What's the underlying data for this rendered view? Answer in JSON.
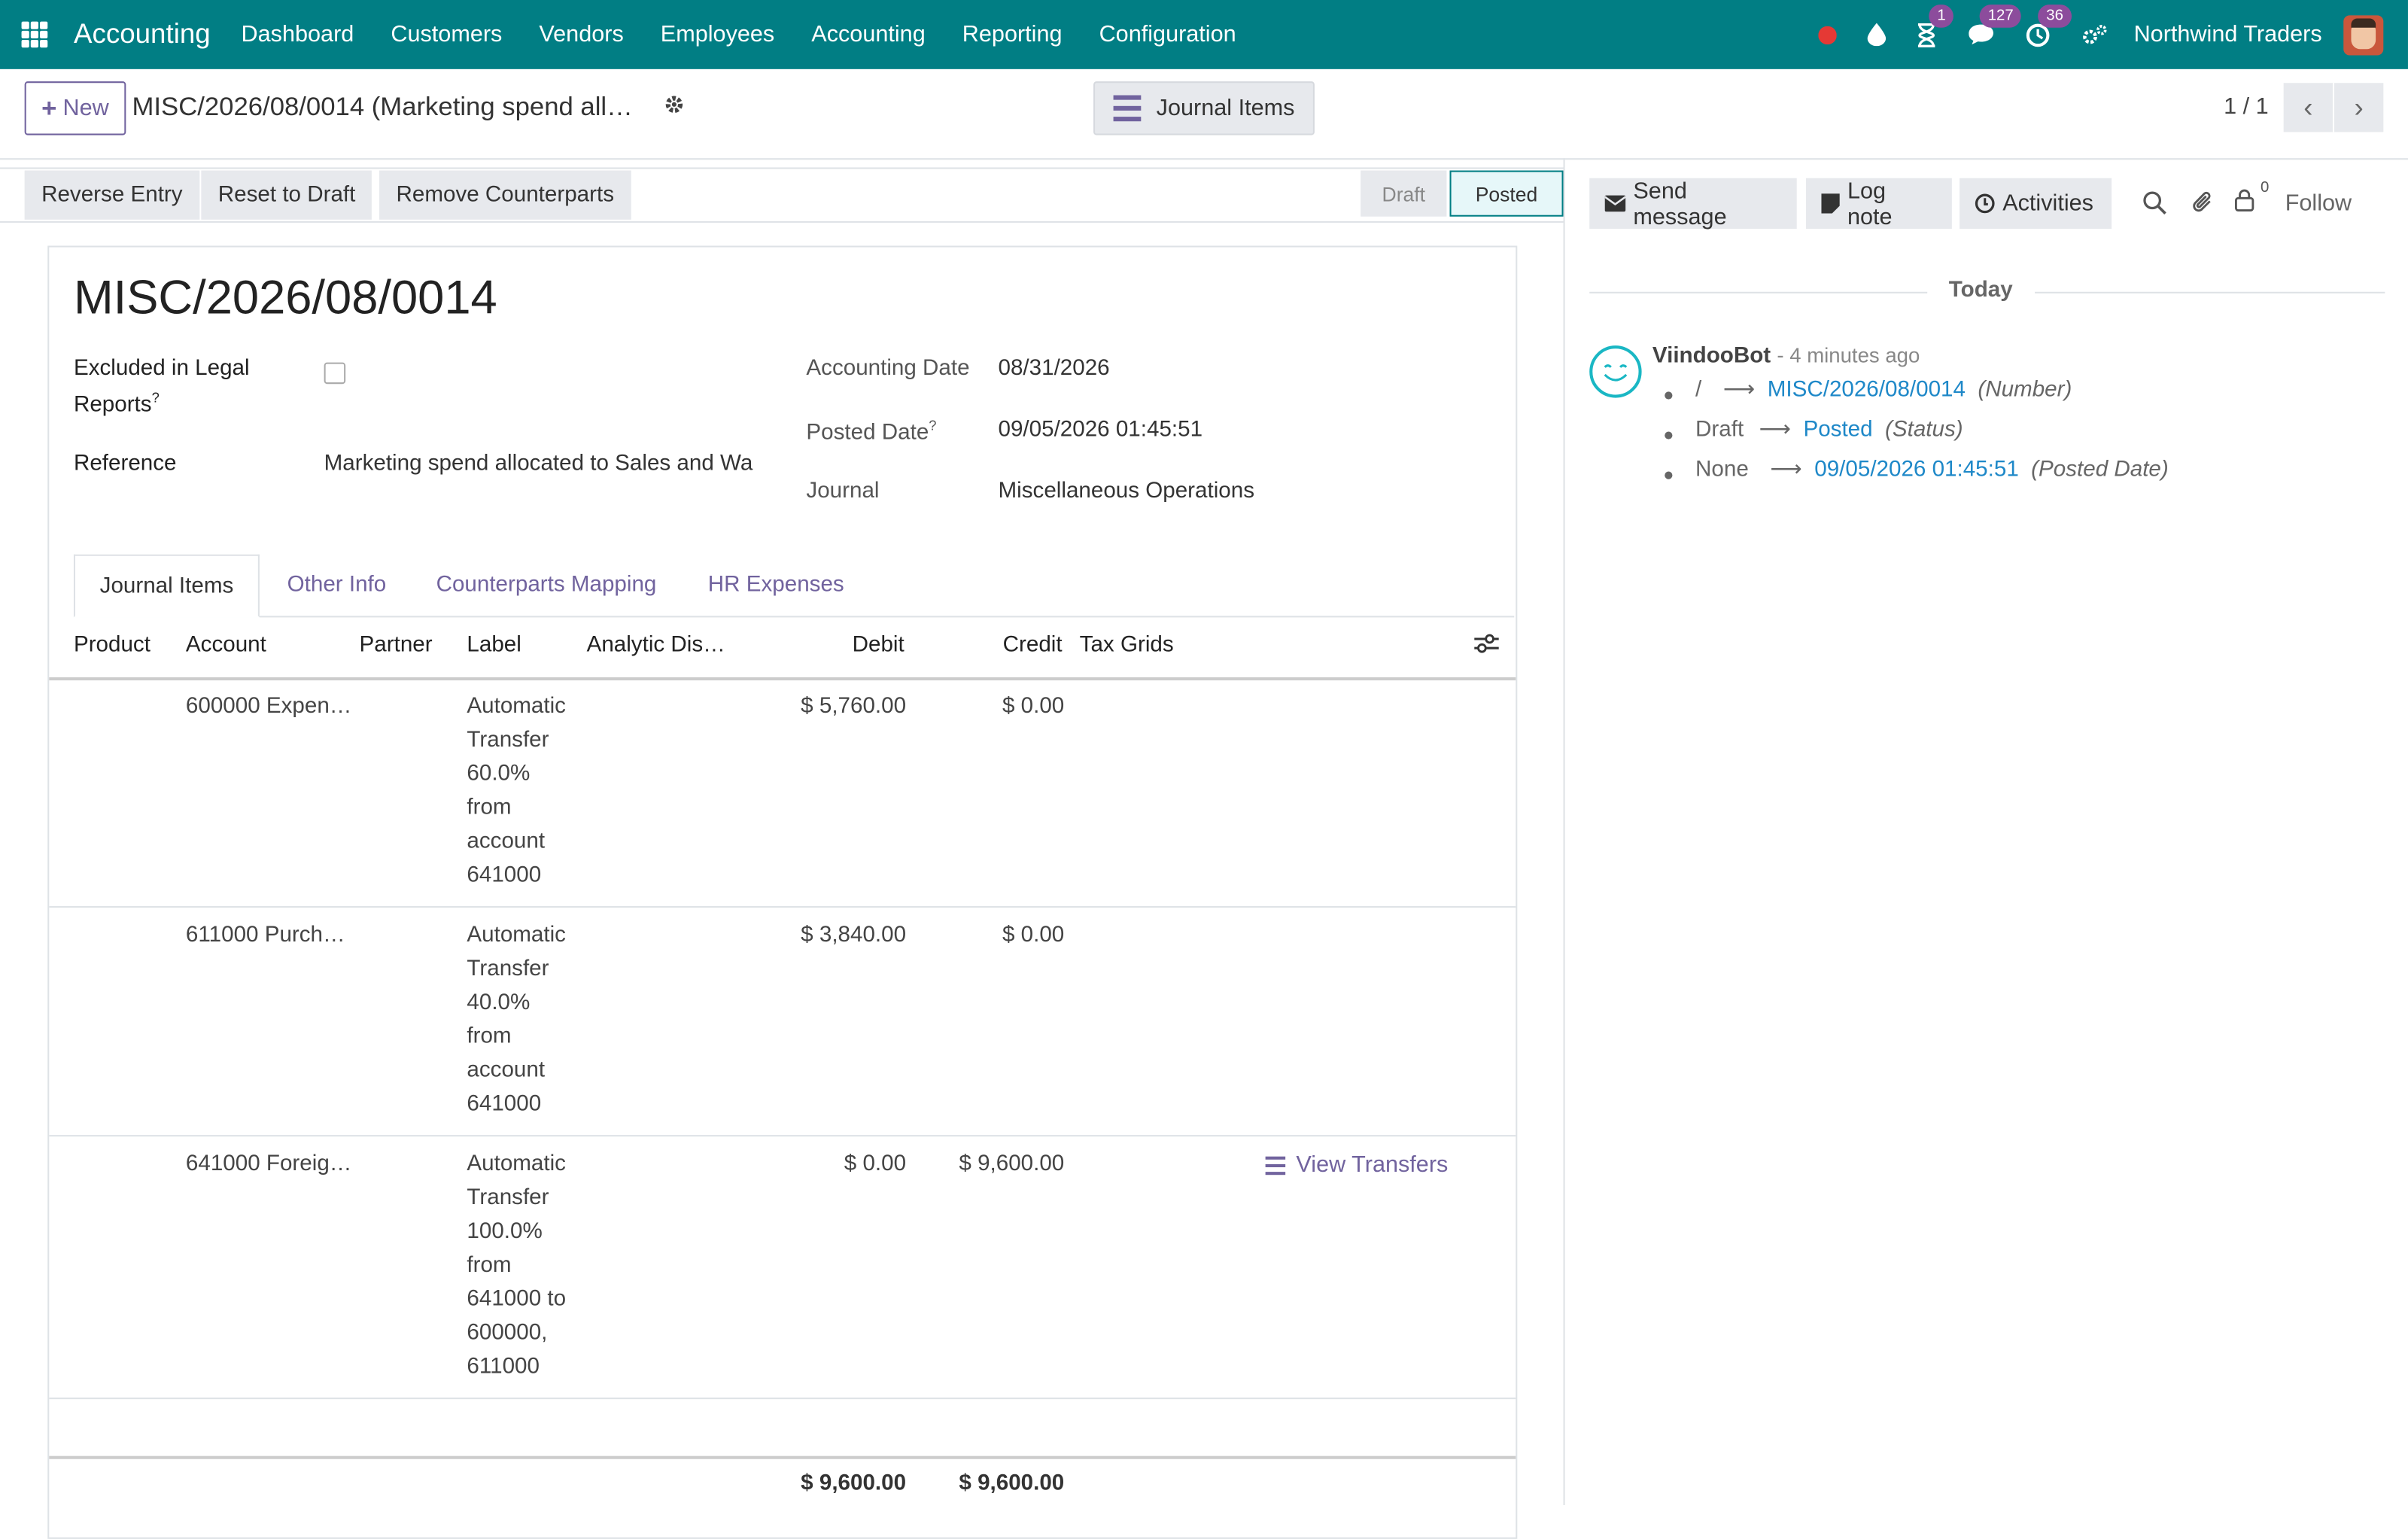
{
  "topbar": {
    "app_name": "Accounting",
    "menu": [
      "Dashboard",
      "Customers",
      "Vendors",
      "Employees",
      "Accounting",
      "Reporting",
      "Configuration"
    ],
    "activity_badge": "1",
    "messages_badge": "127",
    "clock_badge": "36",
    "company": "Northwind Traders",
    "accent": "#017e84"
  },
  "control_panel": {
    "new_label": "New",
    "breadcrumb": "MISC/2026/08/0014 (Marketing spend all…",
    "smart_button": "Journal Items",
    "pager": "1 / 1"
  },
  "statusbar": {
    "buttons": [
      "Reverse Entry",
      "Reset to Draft",
      "Remove Counterparts"
    ],
    "stages": [
      "Draft",
      "Posted"
    ],
    "current_stage": "Posted"
  },
  "form": {
    "title": "MISC/2026/08/0014",
    "excluded_label_line1": "Excluded in Legal",
    "excluded_label_line2": "Reports",
    "excluded_help": "?",
    "reference_label": "Reference",
    "reference_value": "Marketing spend allocated to Sales and Wa",
    "accounting_date_label": "Accounting Date",
    "accounting_date_value": "08/31/2026",
    "posted_date_label": "Posted Date",
    "posted_date_help": "?",
    "posted_date_value": "09/05/2026 01:45:51",
    "journal_label": "Journal",
    "journal_value": "Miscellaneous Operations"
  },
  "tabs": [
    "Journal Items",
    "Other Info",
    "Counterparts Mapping",
    "HR Expenses"
  ],
  "table": {
    "headers": [
      "Product",
      "Account",
      "Partner",
      "Label",
      "Analytic Dis…",
      "Debit",
      "Credit",
      "Tax Grids"
    ],
    "rows": [
      {
        "account": "600000 Expen…",
        "label": [
          "Automatic",
          "Transfer",
          "60.0%",
          "from",
          "account",
          "641000"
        ],
        "debit": "$ 5,760.00",
        "credit": "$ 0.00"
      },
      {
        "account": "611000 Purch…",
        "label": [
          "Automatic",
          "Transfer",
          "40.0%",
          "from",
          "account",
          "641000"
        ],
        "debit": "$ 3,840.00",
        "credit": "$ 0.00"
      },
      {
        "account": "641000 Foreig…",
        "label": [
          "Automatic",
          "Transfer",
          "100.0%",
          "from",
          "641000 to",
          "600000,",
          "611000"
        ],
        "debit": "$ 0.00",
        "credit": "$ 9,600.00",
        "action": "View Transfers"
      }
    ],
    "total_debit": "$ 9,600.00",
    "total_credit": "$ 9,600.00"
  },
  "chatter": {
    "send_message": "Send message",
    "log_note": "Log note",
    "activities": "Activities",
    "followers_count": "0",
    "follow": "Follow",
    "today": "Today",
    "author": "ViindooBot",
    "time": "- 4 minutes ago",
    "changes": [
      {
        "old": "/",
        "new": "MISC/2026/08/0014",
        "field": "(Number)"
      },
      {
        "old": "Draft",
        "new": "Posted",
        "field": "(Status)"
      },
      {
        "old": "None",
        "new": "09/05/2026 01:45:51",
        "field": "(Posted Date)"
      }
    ]
  }
}
